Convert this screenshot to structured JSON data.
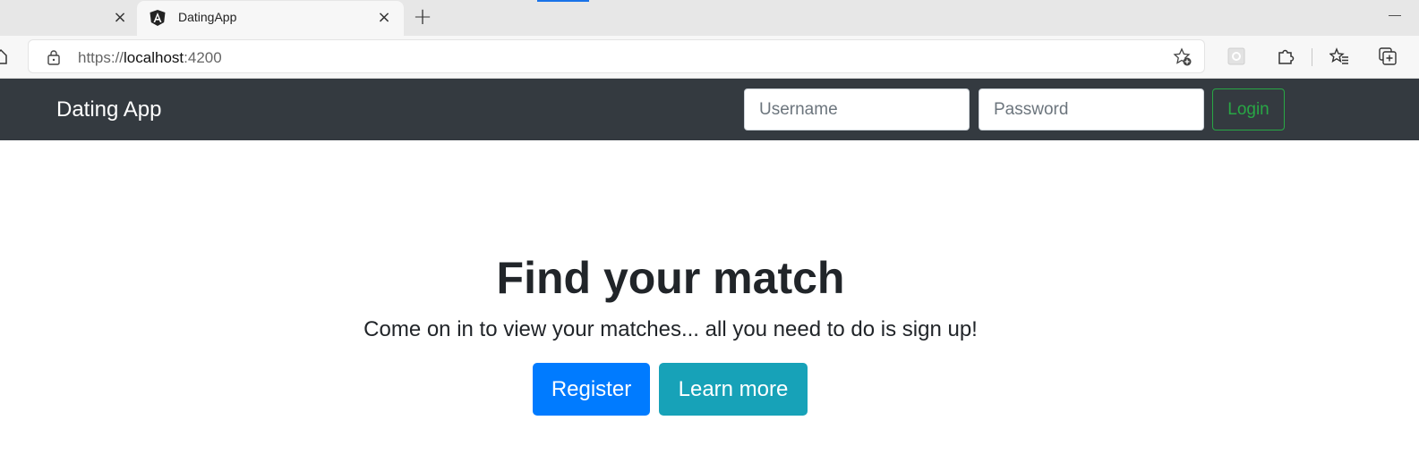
{
  "browser": {
    "active_tab_title": "DatingApp",
    "close_glyph": "×",
    "new_tab_glyph": "+",
    "minimize_glyph": "—",
    "url_scheme": "https://",
    "url_host": "localhost",
    "url_port": ":4200",
    "icons": [
      "home-icon",
      "lock-icon",
      "add-favorite-icon",
      "extension-placeholder-icon",
      "extensions-icon",
      "favorites-icon",
      "collections-icon",
      "angular-favicon"
    ]
  },
  "navbar": {
    "brand": "Dating App",
    "username_placeholder": "Username",
    "password_placeholder": "Password",
    "login_label": "Login"
  },
  "hero": {
    "title": "Find your match",
    "lead": "Come on in to view your matches... all you need to do is sign up!",
    "register_label": "Register",
    "learn_more_label": "Learn more"
  },
  "colors": {
    "navbar_bg": "#343a40",
    "login_outline": "#28a745",
    "register_bg": "#007bff",
    "learn_more_bg": "#17a2b8"
  }
}
